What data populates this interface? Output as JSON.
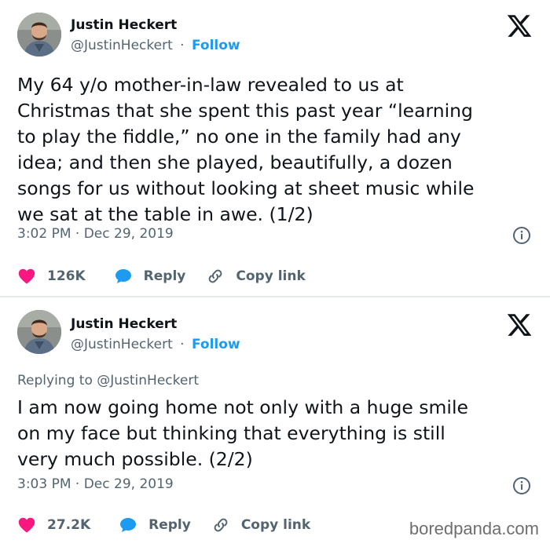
{
  "colors": {
    "text": "#0f1419",
    "secondary": "#536471",
    "accent": "#1d9bf0",
    "like": "#f91880",
    "divider": "#e6e9eb"
  },
  "tweets": [
    {
      "author": {
        "name": "Justin Heckert",
        "handle": "@JustinHeckert",
        "separator": "·",
        "follow_label": "Follow"
      },
      "replying_to": "",
      "text": "My 64 y/o mother-in-law revealed to us at\nChristmas that she spent this past year “learning\nto play the fiddle,” no one in the family had any\nidea; and then she played, beautifully, a dozen\nsongs for us without looking at sheet music while\nwe sat at the table in awe. (1/2)",
      "timestamp": "3:02 PM · Dec 29, 2019",
      "likes": "126K",
      "reply_label": "Reply",
      "copy_link_label": "Copy link",
      "icons": [
        "avatar",
        "x-logo-icon",
        "info-icon",
        "heart-icon",
        "reply-bubble-icon",
        "link-icon"
      ]
    },
    {
      "author": {
        "name": "Justin Heckert",
        "handle": "@JustinHeckert",
        "separator": "·",
        "follow_label": "Follow"
      },
      "replying_to": "Replying to @JustinHeckert",
      "text": "I am now going home not only with a huge smile\non my face but thinking that everything is still\nvery much possible. (2/2)",
      "timestamp": "3:03 PM · Dec 29, 2019",
      "likes": "27.2K",
      "reply_label": "Reply",
      "copy_link_label": "Copy link",
      "icons": [
        "avatar",
        "x-logo-icon",
        "info-icon",
        "heart-icon",
        "reply-bubble-icon",
        "link-icon"
      ]
    }
  ],
  "watermark": "boredpanda.com"
}
